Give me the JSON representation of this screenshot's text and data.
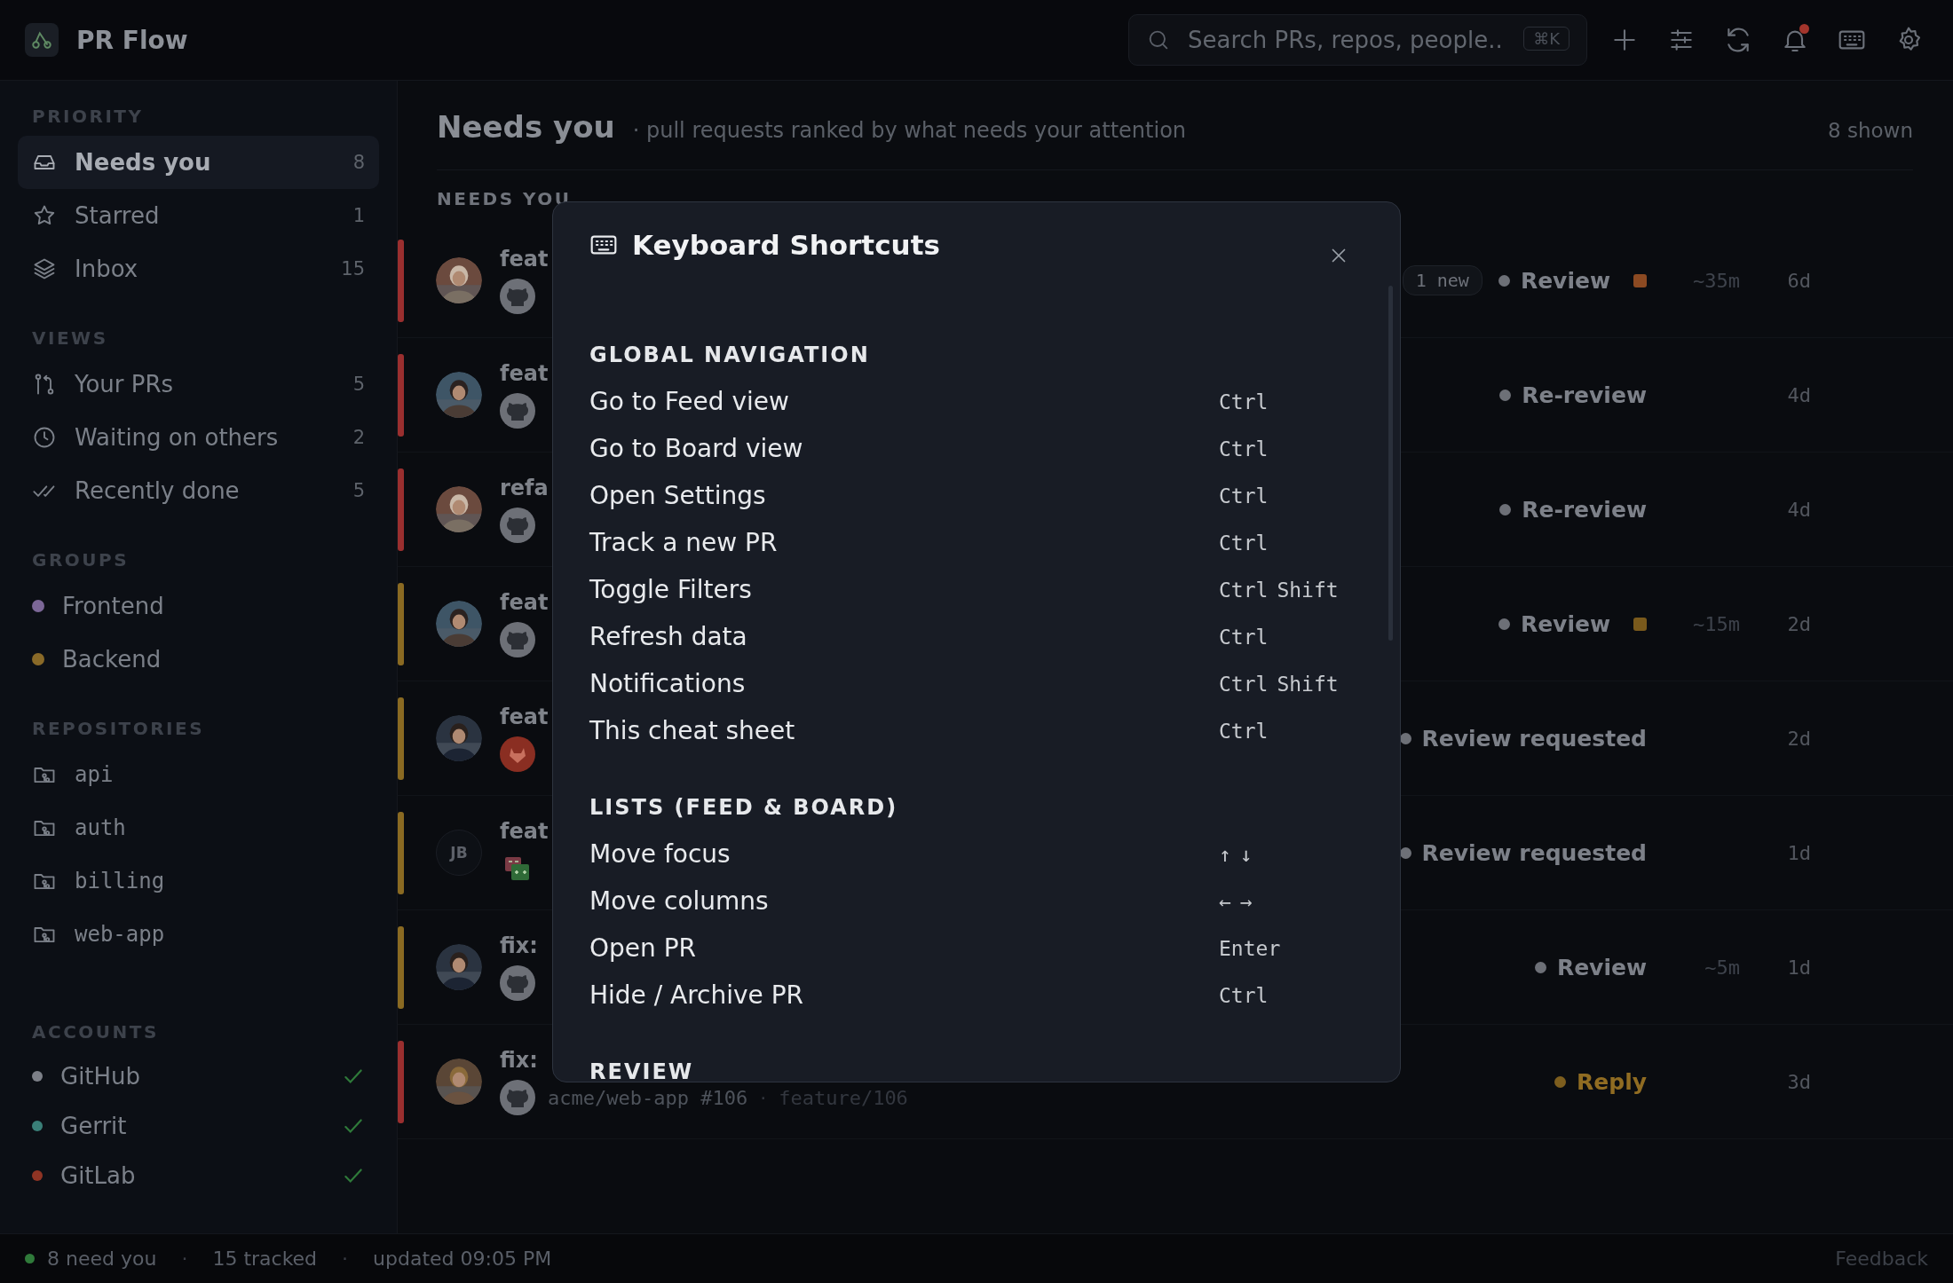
{
  "app": {
    "title": "PR Flow"
  },
  "search": {
    "placeholder": "Search PRs, repos, people..",
    "shortcut": "⌘K"
  },
  "notifications": {
    "unread": true
  },
  "sidebar": {
    "sections": [
      {
        "title": "PRIORITY",
        "kind": "nav",
        "items": [
          {
            "label": "Needs you",
            "count": "8",
            "selected": true
          },
          {
            "label": "Starred",
            "count": "1",
            "selected": false
          },
          {
            "label": "Inbox",
            "count": "15",
            "selected": false
          }
        ]
      },
      {
        "title": "VIEWS",
        "kind": "nav",
        "items": [
          {
            "label": "Your PRs",
            "count": "5",
            "selected": false
          },
          {
            "label": "Waiting on others",
            "count": "2",
            "selected": false
          },
          {
            "label": "Recently done",
            "count": "5",
            "selected": false
          }
        ]
      },
      {
        "title": "GROUPS",
        "kind": "group",
        "items": [
          {
            "label": "Frontend",
            "color": "#7c6797"
          },
          {
            "label": "Backend",
            "color": "#8a6a28"
          }
        ]
      },
      {
        "title": "REPOSITORIES",
        "kind": "repo",
        "items": [
          {
            "label": "api"
          },
          {
            "label": "auth"
          },
          {
            "label": "billing"
          },
          {
            "label": "web-app"
          }
        ]
      },
      {
        "title": "ACCOUNTS",
        "kind": "account",
        "items": [
          {
            "label": "GitHub",
            "color": "#7d8088",
            "connected": true
          },
          {
            "label": "Gerrit",
            "color": "#3a7f78",
            "connected": true
          },
          {
            "label": "GitLab",
            "color": "#8f3424",
            "connected": true
          }
        ]
      }
    ]
  },
  "main": {
    "title": "Needs you",
    "subtitle": "· pull requests ranked by what needs your attention",
    "shown": "8 shown",
    "section_label": "NEEDS YOU",
    "rows": [
      {
        "priority": {
          "color": "#9a2f2f"
        },
        "title": "feat",
        "provider": {
          "kind": "github"
        },
        "badge": "1 new",
        "status": {
          "label": "Review",
          "color": "#6d7077"
        },
        "estimate": {
          "label": "~35m",
          "color": "#8c4a22"
        },
        "age": "6d"
      },
      {
        "priority": {
          "color": "#9a2f2f"
        },
        "title": "feat",
        "provider": {
          "kind": "github"
        },
        "status": {
          "label": "Re-review",
          "color": "#6d7077"
        },
        "age": "4d"
      },
      {
        "priority": {
          "color": "#9a2f2f"
        },
        "title": "refa",
        "provider": {
          "kind": "github"
        },
        "status": {
          "label": "Re-review",
          "color": "#6d7077"
        },
        "age": "4d"
      },
      {
        "priority": {
          "color": "#8a6a22"
        },
        "title": "feat",
        "provider": {
          "kind": "github"
        },
        "status": {
          "label": "Review",
          "color": "#6d7077"
        },
        "estimate": {
          "label": "~15m",
          "color": "#7a5a1c"
        },
        "age": "2d"
      },
      {
        "priority": {
          "color": "#8a6a22"
        },
        "title": "feat",
        "provider": {
          "kind": "gitlab"
        },
        "status": {
          "label": "Review requested",
          "color": "#6d7077"
        },
        "age": "2d"
      },
      {
        "priority": {
          "color": "#8a6a22"
        },
        "avatar": {
          "kind": "initials",
          "initials": "JB"
        },
        "title": "feat",
        "provider": {
          "kind": "gerrit"
        },
        "status": {
          "label": "Review requested",
          "color": "#6d7077"
        },
        "age": "1d"
      },
      {
        "priority": {
          "color": "#8a6a22"
        },
        "title": "fix:",
        "provider": {
          "kind": "github"
        },
        "status": {
          "label": "Review",
          "color": "#6d7077"
        },
        "estimate": {
          "label": "~5m"
        },
        "age": "1d"
      },
      {
        "priority": {
          "color": "#9a2f2f"
        },
        "title": "fix:",
        "provider": {
          "kind": "github"
        },
        "repo": "acme/web-app #106",
        "separator": "·",
        "branch": "feature/106",
        "status": {
          "label": "Reply",
          "color": "#7d5e1e"
        },
        "age": "3d"
      }
    ]
  },
  "modal": {
    "title": "Keyboard Shortcuts",
    "sections": [
      {
        "title": "GLOBAL NAVIGATION",
        "items": [
          {
            "label": "Go to Feed view",
            "keys": [
              "Ctrl"
            ]
          },
          {
            "label": "Go to Board view",
            "keys": [
              "Ctrl"
            ]
          },
          {
            "label": "Open Settings",
            "keys": [
              "Ctrl"
            ]
          },
          {
            "label": "Track a new PR",
            "keys": [
              "Ctrl"
            ]
          },
          {
            "label": "Toggle Filters",
            "keys": [
              "Ctrl",
              "Shift"
            ]
          },
          {
            "label": "Refresh data",
            "keys": [
              "Ctrl"
            ]
          },
          {
            "label": "Notifications",
            "keys": [
              "Ctrl",
              "Shift"
            ]
          },
          {
            "label": "This cheat sheet",
            "keys": [
              "Ctrl"
            ]
          }
        ]
      },
      {
        "title": "LISTS (FEED & BOARD)",
        "items": [
          {
            "label": "Move focus",
            "keys": [
              "↑",
              "↓"
            ]
          },
          {
            "label": "Move columns",
            "keys": [
              "←",
              "→"
            ]
          },
          {
            "label": "Open PR",
            "keys": [
              "Enter"
            ]
          },
          {
            "label": "Hide / Archive PR",
            "keys": [
              "Ctrl"
            ]
          }
        ]
      },
      {
        "title": "REVIEW"
      }
    ]
  },
  "status_bar": {
    "online": true,
    "need": "8 need you",
    "sep1": "·",
    "tracked": "15 tracked",
    "sep2": "·",
    "updated": "updated 09:05 PM",
    "feedback": "Feedback"
  }
}
